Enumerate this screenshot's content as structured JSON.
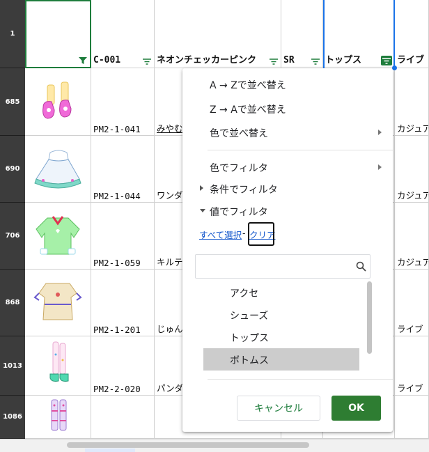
{
  "header_row": {
    "row_number": "1",
    "columns": [
      "",
      "C-001",
      "ネオンチェッカーピンク",
      "SR",
      "トップス",
      "ライブ"
    ]
  },
  "rows": [
    {
      "row_number": "685",
      "code": "PM2-1-041",
      "name": "みやむ",
      "type": "",
      "category": "カジュア"
    },
    {
      "row_number": "690",
      "code": "PM2-1-044",
      "name": "ワンダ",
      "type": "",
      "category": "カジュア"
    },
    {
      "row_number": "706",
      "code": "PM2-1-059",
      "name": "キルテ",
      "type": "",
      "category": "カジュア"
    },
    {
      "row_number": "868",
      "code": "PM2-1-201",
      "name": "じゅん",
      "type": "",
      "category": "ライブ"
    },
    {
      "row_number": "1013",
      "code": "PM2-2-020",
      "name": "パンダ",
      "type": "",
      "category": "ライブ"
    },
    {
      "row_number": "1086",
      "code": "",
      "name": "",
      "type": "",
      "category": ""
    }
  ],
  "filter_menu": {
    "sort_az": "A → Zで並べ替え",
    "sort_za": "Z → Aで並べ替え",
    "sort_color": "色で並べ替え",
    "filter_color": "色でフィルタ",
    "filter_condition": "条件でフィルタ",
    "filter_values": "値でフィルタ",
    "select_all": "すべて選択",
    "separator": "-",
    "clear": "クリア",
    "search_value": "",
    "values": [
      "アクセ",
      "シューズ",
      "トップス",
      "ボトムス"
    ],
    "selected_value": "ボトムス",
    "cancel": "キャンセル",
    "ok": "OK"
  },
  "colors": {
    "accent_green": "#2e7d32",
    "selection_blue": "#1a73e8",
    "link_blue": "#1155cc",
    "row_header_bg": "#3c3c3c"
  },
  "icons": [
    "filter-icon",
    "filter-active-icon",
    "submenu-arrow-icon",
    "expand-triangle-icon",
    "search-icon"
  ]
}
